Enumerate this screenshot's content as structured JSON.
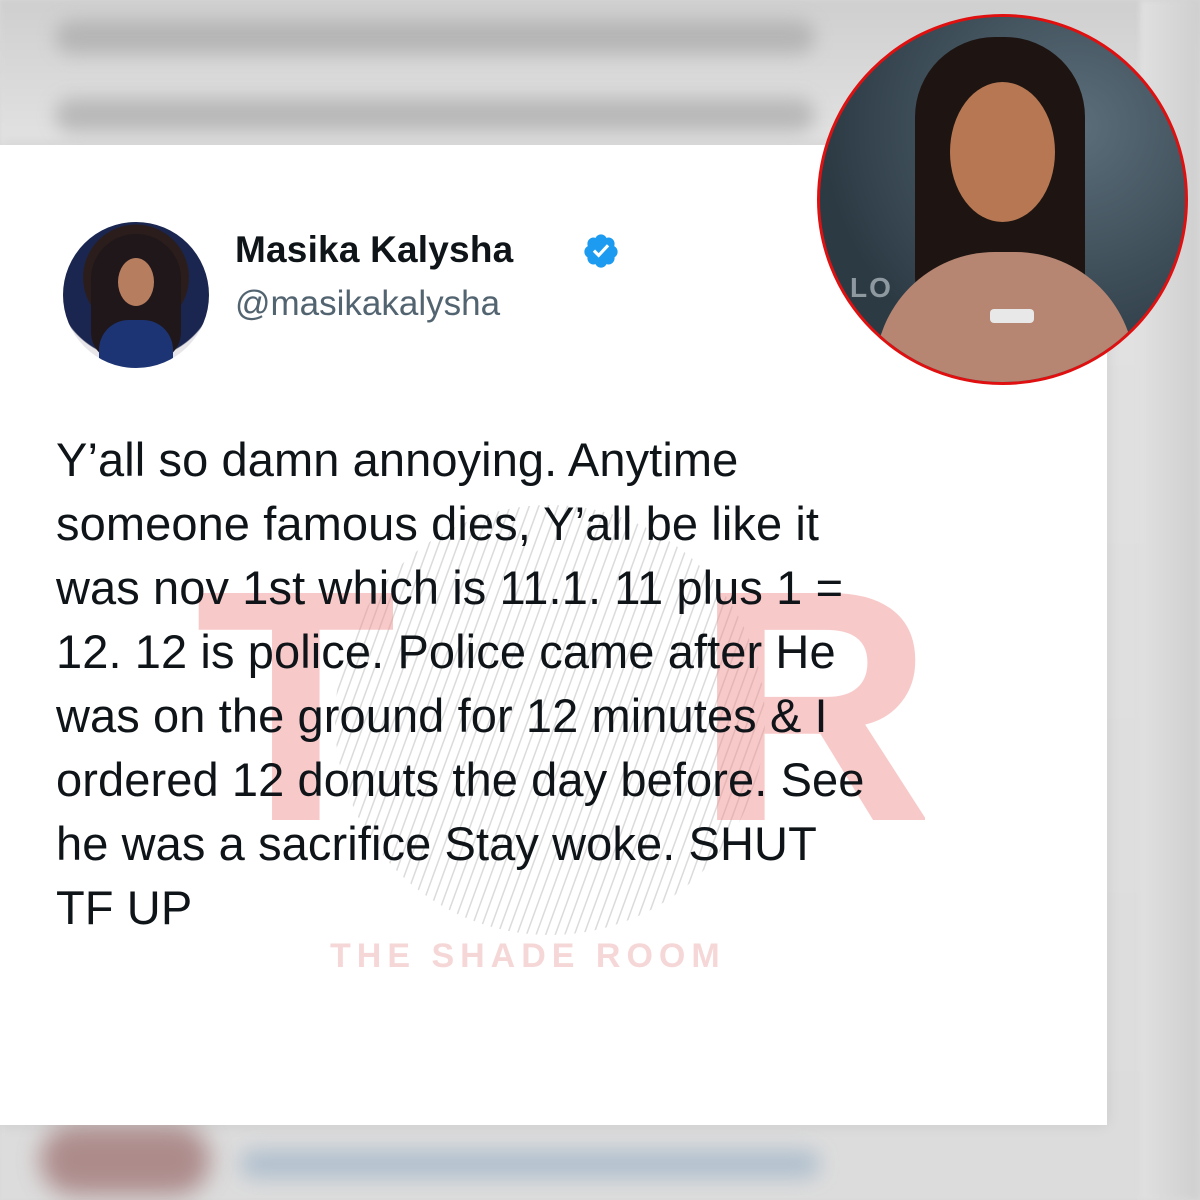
{
  "background": {
    "accent": "#e01010"
  },
  "tweet": {
    "display_name": "Masika Kalysha",
    "handle": "@masikakalysha",
    "verified": true,
    "verified_color": "#1d9bf0",
    "text": "Y’all so damn annoying. Anytime\nsomeone famous dies, Y’all be like it\nwas nov 1st which is 11.1. 11 plus 1 =\n12. 12 is police. Police came after He\nwas on the ground for 12 minutes & I\nordered 12 donuts the day before. See\nhe was a sacrifice Stay woke. SHUT\nTF UP"
  },
  "watermark": {
    "letters": "TSR",
    "caption": "THE SHADE ROOM",
    "color": "#f08a8a"
  },
  "inset_photo": {
    "border_color": "#e01010",
    "sign_text": "LO"
  }
}
